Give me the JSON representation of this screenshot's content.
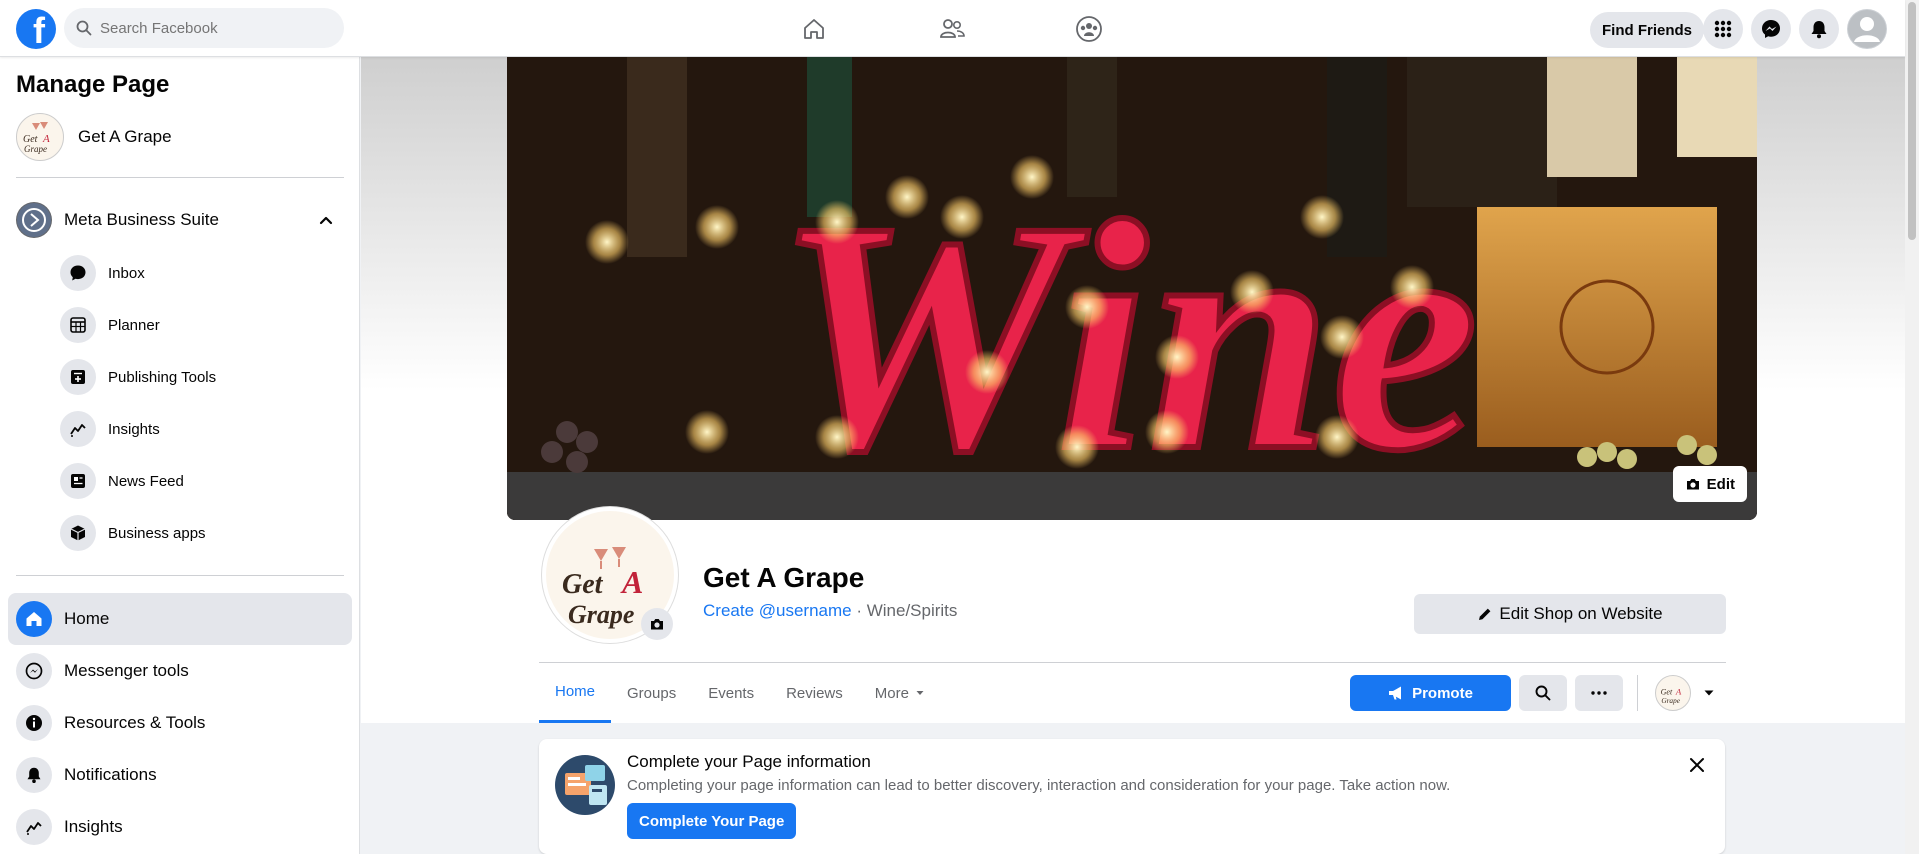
{
  "topbar": {
    "search_placeholder": "Search Facebook",
    "find_friends": "Find Friends"
  },
  "sidebar": {
    "title": "Manage Page",
    "page_name": "Get A Grape",
    "suite": {
      "label": "Meta Business Suite",
      "items": [
        {
          "label": "Inbox",
          "icon": "chat-bubble-icon"
        },
        {
          "label": "Planner",
          "icon": "calendar-grid-icon"
        },
        {
          "label": "Publishing Tools",
          "icon": "publishing-tools-icon"
        },
        {
          "label": "Insights",
          "icon": "insights-trend-icon"
        },
        {
          "label": "News Feed",
          "icon": "news-feed-icon"
        },
        {
          "label": "Business apps",
          "icon": "cube-icon"
        }
      ]
    },
    "main_items": [
      {
        "label": "Home",
        "icon": "home-icon"
      },
      {
        "label": "Messenger tools",
        "icon": "messenger-icon"
      },
      {
        "label": "Resources & Tools",
        "icon": "info-icon"
      },
      {
        "label": "Notifications",
        "icon": "bell-icon"
      },
      {
        "label": "Insights",
        "icon": "insights-trend-icon"
      }
    ]
  },
  "profile": {
    "cover_edit": "Edit",
    "cover_sign_text": "Wine",
    "name": "Get A Grape",
    "username_link": "Create @username",
    "category": " · Wine/Spirits",
    "edit_shop": "Edit Shop on Website",
    "tabs": [
      "Home",
      "Groups",
      "Events",
      "Reviews",
      "More"
    ],
    "promote": "Promote"
  },
  "logo_text": {
    "line1": "Get",
    "letter": "A",
    "line2": "Grape"
  },
  "info_card": {
    "title": "Complete your Page information",
    "body": "Completing your page information can lead to better discovery, interaction and consideration for your page. Take action now.",
    "button": "Complete Your Page"
  },
  "colors": {
    "brand_blue": "#1877f2",
    "secondary_bg": "#e4e6eb",
    "page_bg": "#f0f2f5",
    "wine_red": "#e8234a"
  }
}
